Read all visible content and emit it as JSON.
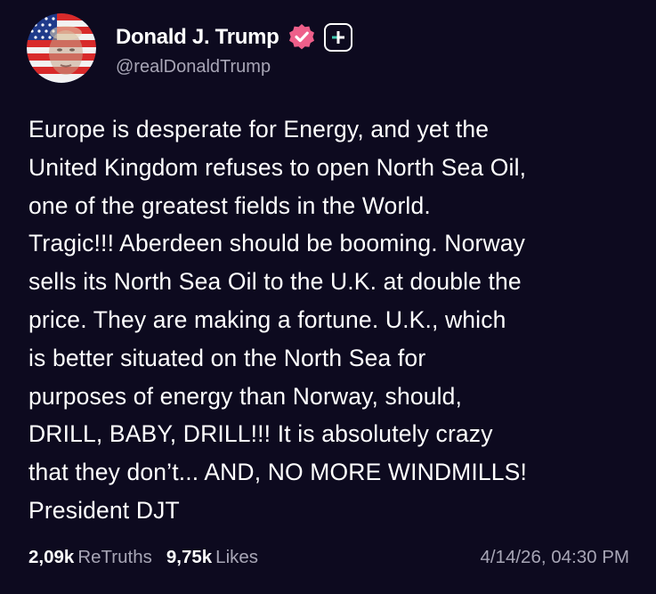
{
  "post": {
    "author": {
      "display_name": "Donald J. Trump",
      "handle": "@realDonaldTrump",
      "verified_icon": "verified-badge-icon",
      "avatar": "profile-avatar",
      "action_icon": "plus-icon"
    },
    "text": "Europe is desperate for Energy, and yet the\nUnited Kingdom refuses to open North Sea Oil,\none of the greatest fields in the World.\nTragic!!! Aberdeen should be booming. Norway\nsells its North Sea Oil to the U.K. at double the\nprice. They are making a fortune. U.K., which\nis better situated on the North Sea for\npurposes of energy than Norway, should,\nDRILL, BABY, DRILL!!! It is absolutely crazy\nthat they don’t... AND, NO MORE WINDMILLS!\nPresident DJT",
    "stats": {
      "retruths_count": "2,09k",
      "retruths_label": "ReTruths",
      "likes_count": "9,75k",
      "likes_label": "Likes"
    },
    "timestamp": "4/14/26, 04:30 PM"
  },
  "colors": {
    "background": "#0d0a1f",
    "text": "#ffffff",
    "muted": "#a8a6b6",
    "verified_badge": "#ee5f8a"
  }
}
